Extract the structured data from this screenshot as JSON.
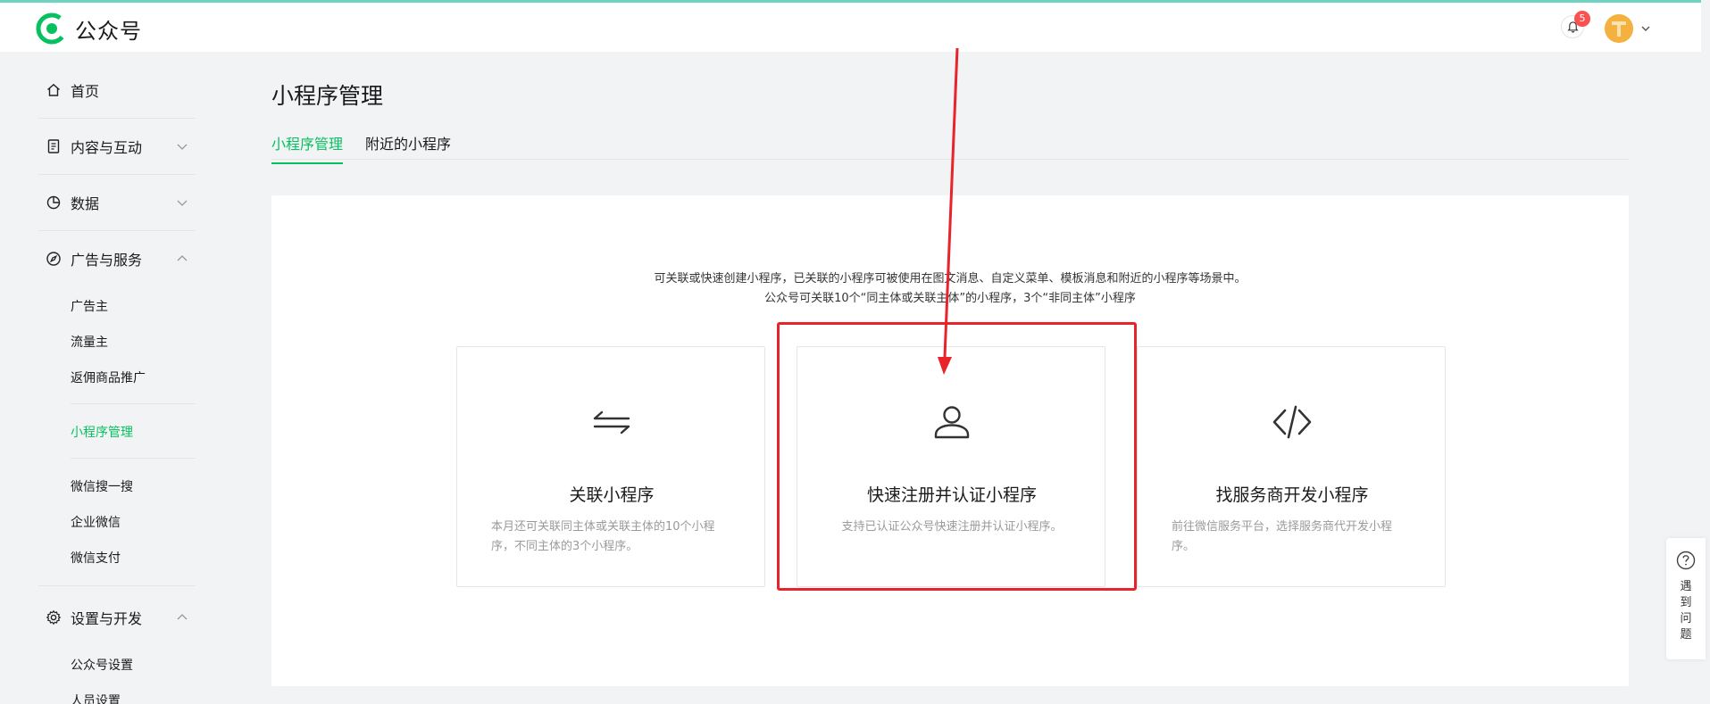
{
  "header": {
    "logo_text": "公众号",
    "notification_count": "5",
    "accent_color": "#07c160"
  },
  "sidebar": {
    "items": [
      {
        "label": "首页",
        "icon": "home-icon"
      },
      {
        "label": "内容与互动",
        "icon": "document-icon",
        "expanded": false
      },
      {
        "label": "数据",
        "icon": "chart-icon",
        "expanded": false
      },
      {
        "label": "广告与服务",
        "icon": "compass-icon",
        "expanded": true,
        "children": [
          "广告主",
          "流量主",
          "返佣商品推广",
          "小程序管理",
          "微信搜一搜",
          "企业微信",
          "微信支付"
        ]
      },
      {
        "label": "设置与开发",
        "icon": "gear-icon",
        "expanded": true,
        "children": [
          "公众号设置",
          "人员设置"
        ]
      }
    ],
    "active_item": "小程序管理"
  },
  "main": {
    "title": "小程序管理",
    "tabs": [
      {
        "label": "小程序管理",
        "active": true
      },
      {
        "label": "附近的小程序",
        "active": false
      }
    ],
    "description_line1": "可关联或快速创建小程序，已关联的小程序可被使用在图文消息、自定义菜单、模板消息和附近的小程序等场景中。",
    "description_line2": "公众号可关联10个“同主体或关联主体”的小程序，3个“非同主体”小程序",
    "options": [
      {
        "title": "关联小程序",
        "desc": "本月还可关联同主体或关联主体的10个小程序，不同主体的3个小程序。",
        "icon": "swap-arrows-icon"
      },
      {
        "title": "快速注册并认证小程序",
        "desc": "支持已认证公众号快速注册并认证小程序。",
        "icon": "user-icon"
      },
      {
        "title": "找服务商开发小程序",
        "desc": "前往微信服务平台，选择服务商代开发小程序。",
        "icon": "code-icon"
      }
    ]
  },
  "help": {
    "label": "遇到问题",
    "icon": "question-icon"
  },
  "annotation": {
    "highlight_color": "#e8232a"
  }
}
